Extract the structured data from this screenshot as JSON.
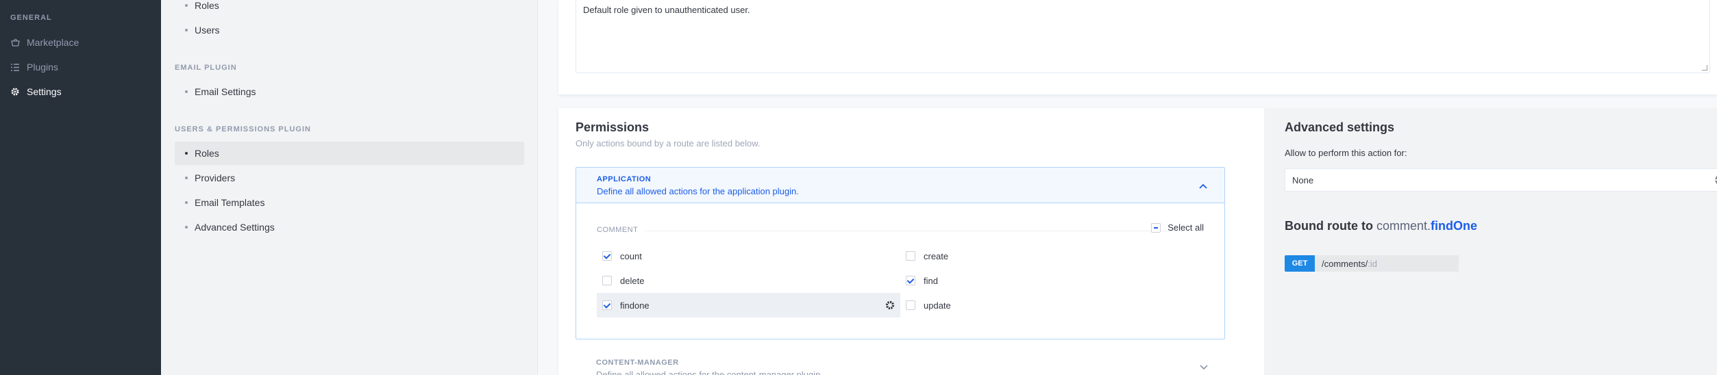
{
  "leftnav": {
    "heading": "General",
    "items": [
      {
        "label": "Marketplace",
        "icon": "basket-icon"
      },
      {
        "label": "Plugins",
        "icon": "list-icon"
      },
      {
        "label": "Settings",
        "icon": "gear-icon",
        "active": true
      }
    ]
  },
  "subnav": {
    "top_items": [
      "Roles",
      "Users"
    ],
    "email_plugin": {
      "heading": "Email Plugin",
      "items": [
        "Email Settings"
      ]
    },
    "users_permissions": {
      "heading": "Users & Permissions Plugin",
      "items": [
        "Roles",
        "Providers",
        "Email Templates",
        "Advanced Settings"
      ],
      "active": "Roles"
    }
  },
  "description_value": "Default role given to unauthenticated user.",
  "permissions": {
    "title": "Permissions",
    "subtitle": "Only actions bound by a route are listed below.",
    "application": {
      "name": "Application",
      "description": "Define all allowed actions for the application plugin.",
      "controller": "comment",
      "select_all": "Select all",
      "actions": [
        {
          "label": "count",
          "checked": true
        },
        {
          "label": "create",
          "checked": false
        },
        {
          "label": "delete",
          "checked": false
        },
        {
          "label": "find",
          "checked": true
        },
        {
          "label": "findone",
          "checked": true
        },
        {
          "label": "update",
          "checked": false
        }
      ]
    },
    "content_manager": {
      "name": "Content-Manager",
      "description": "Define all allowed actions for the content-manager plugin."
    }
  },
  "advanced": {
    "title": "Advanced settings",
    "allow_label": "Allow to perform this action for:",
    "allow_value": "None",
    "bound_route_label": "Bound route to",
    "bound_controller": "comment.",
    "bound_action": "findOne",
    "route_verb": "GET",
    "route_path": "/comments/",
    "route_param": ":id"
  },
  "colors": {
    "accent": "#1c5de7",
    "nav_bg": "#28303a"
  }
}
